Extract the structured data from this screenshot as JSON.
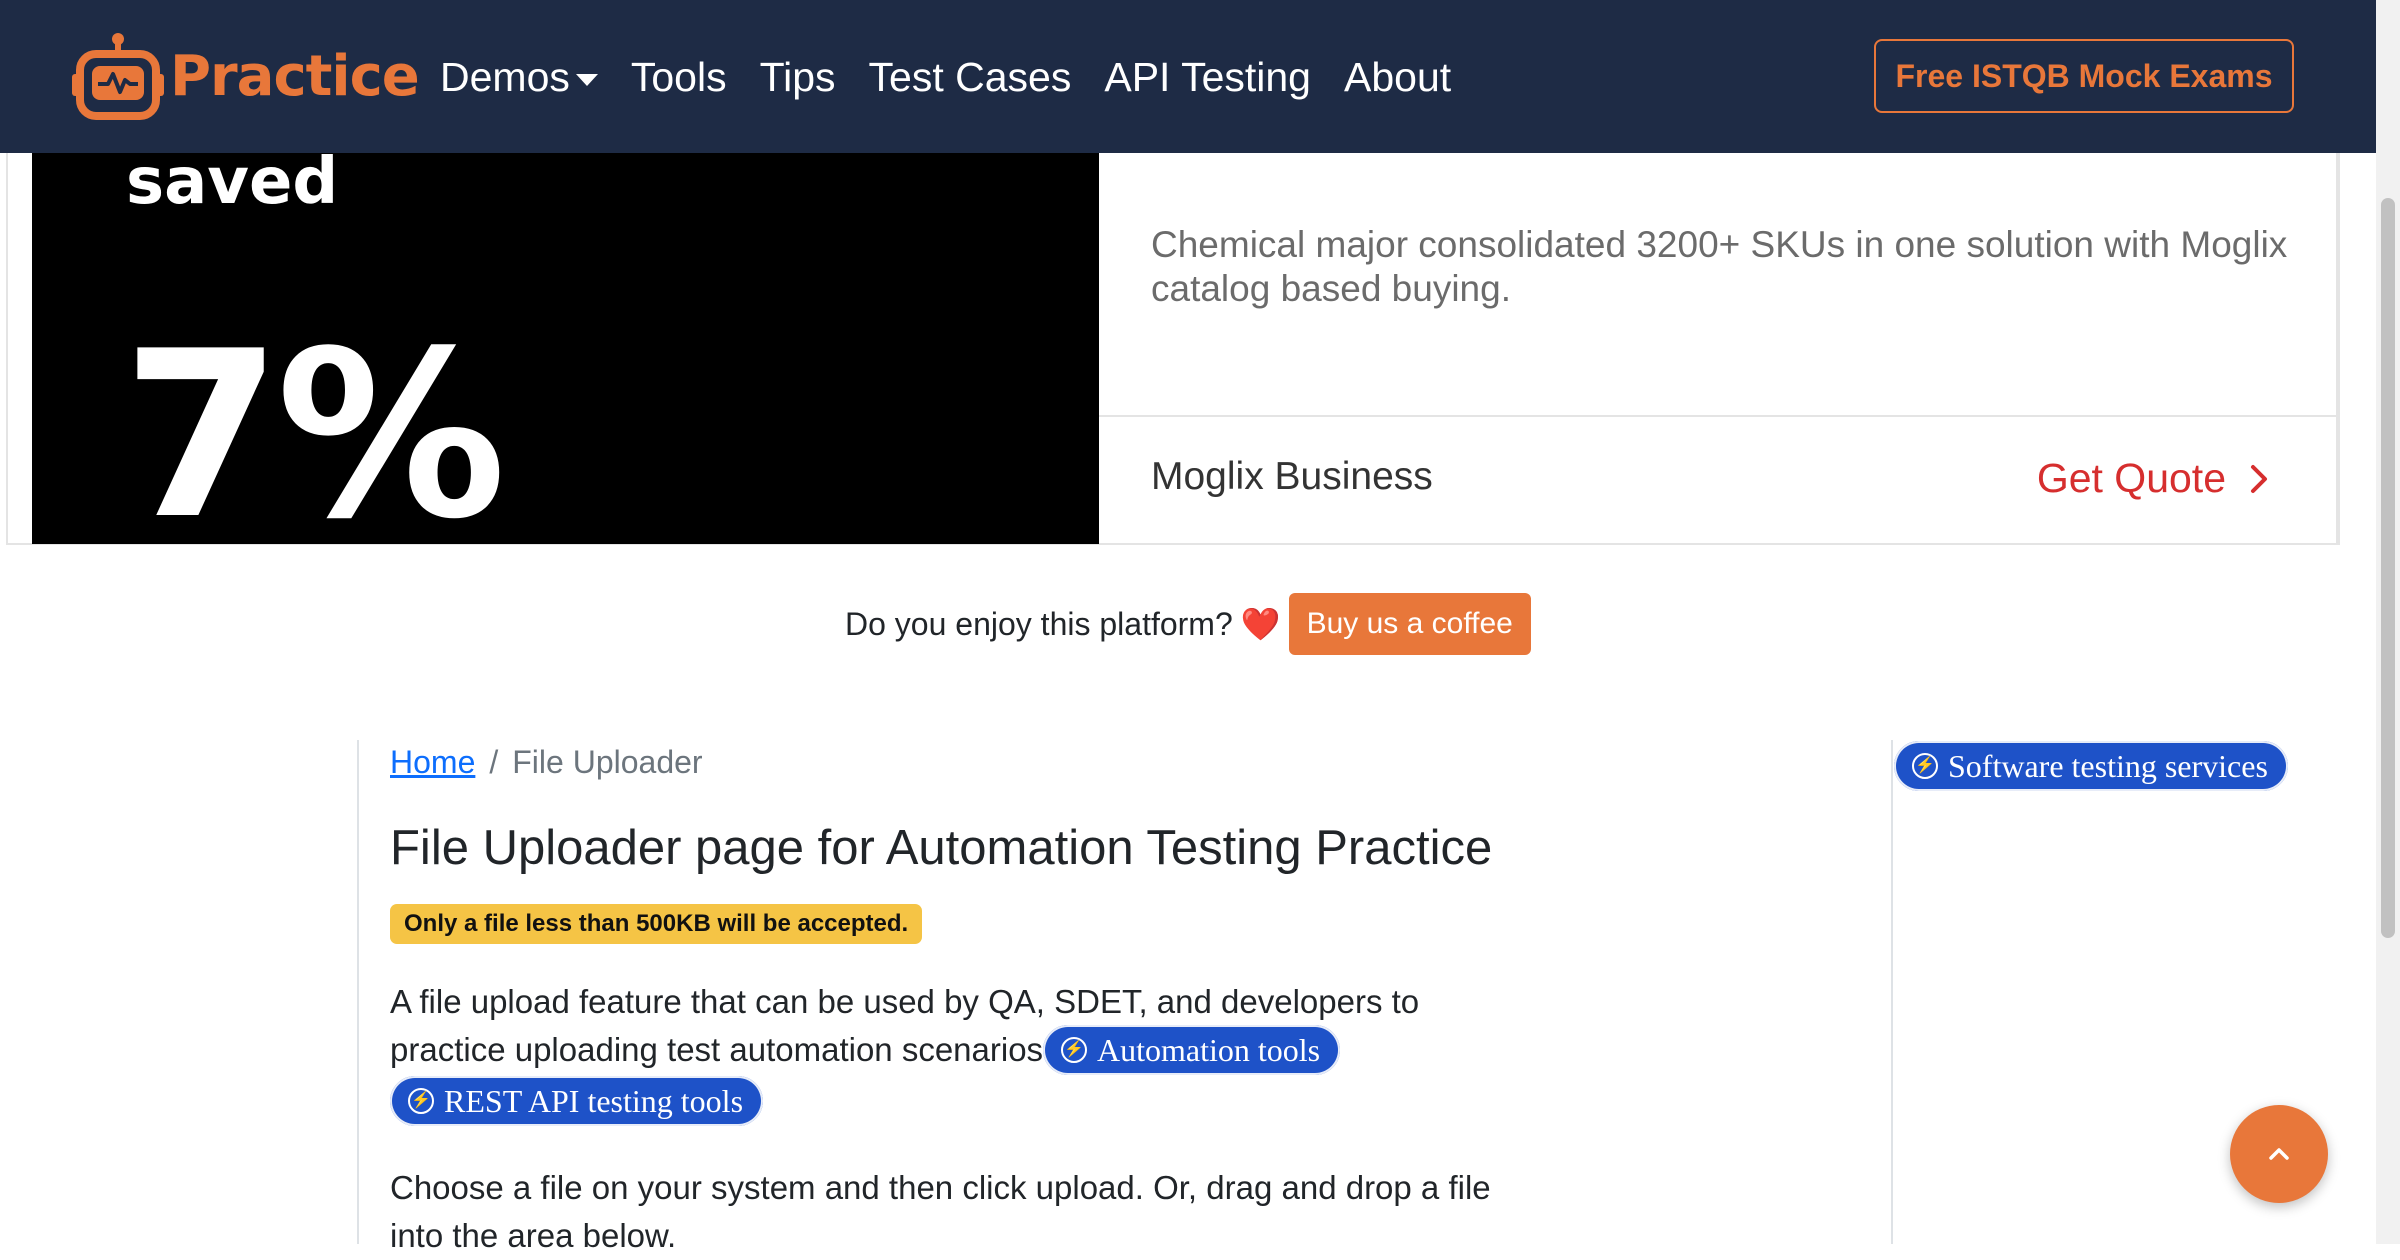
{
  "navbar": {
    "brand": "Practice",
    "links": [
      "Demos",
      "Tools",
      "Tips",
      "Test Cases",
      "API Testing",
      "About"
    ],
    "cta": "Free ISTQB Mock Exams"
  },
  "ad": {
    "saved_text": "saved",
    "percent_text": "7%",
    "description": "Chemical major consolidated 3200+ SKUs in one solution with Moglix catalog based buying.",
    "brand": "Moglix Business",
    "cta": "Get Quote"
  },
  "coffee": {
    "question": "Do you enjoy this platform?",
    "heart": "❤️",
    "button": "Buy us a coffee"
  },
  "breadcrumb": {
    "home": "Home",
    "separator": "/",
    "current": "File Uploader"
  },
  "main": {
    "title": "File Uploader page for Automation Testing Practice",
    "warning": "Only a file less than 500KB will be accepted.",
    "intro": "A file upload feature that can be used by QA, SDET, and developers to practice uploading test automation scenarios",
    "pill_automation": "Automation tools",
    "pill_rest": "REST API testing tools",
    "instructions": "Choose a file on your system and then click upload. Or, drag and drop a file into the area below."
  },
  "sidebar": {
    "pill": "Software testing services"
  },
  "colors": {
    "navbar_bg": "#1e2b45",
    "accent_orange": "#e8773a",
    "pill_blue": "#1e52c8",
    "warning_yellow": "#f5c445",
    "quote_red": "#d62e2e"
  },
  "icons": [
    "robot-logo-icon",
    "chevron-down-icon",
    "chevron-right-icon",
    "heart-icon",
    "bolt-circle-icon",
    "chevron-up-icon"
  ]
}
